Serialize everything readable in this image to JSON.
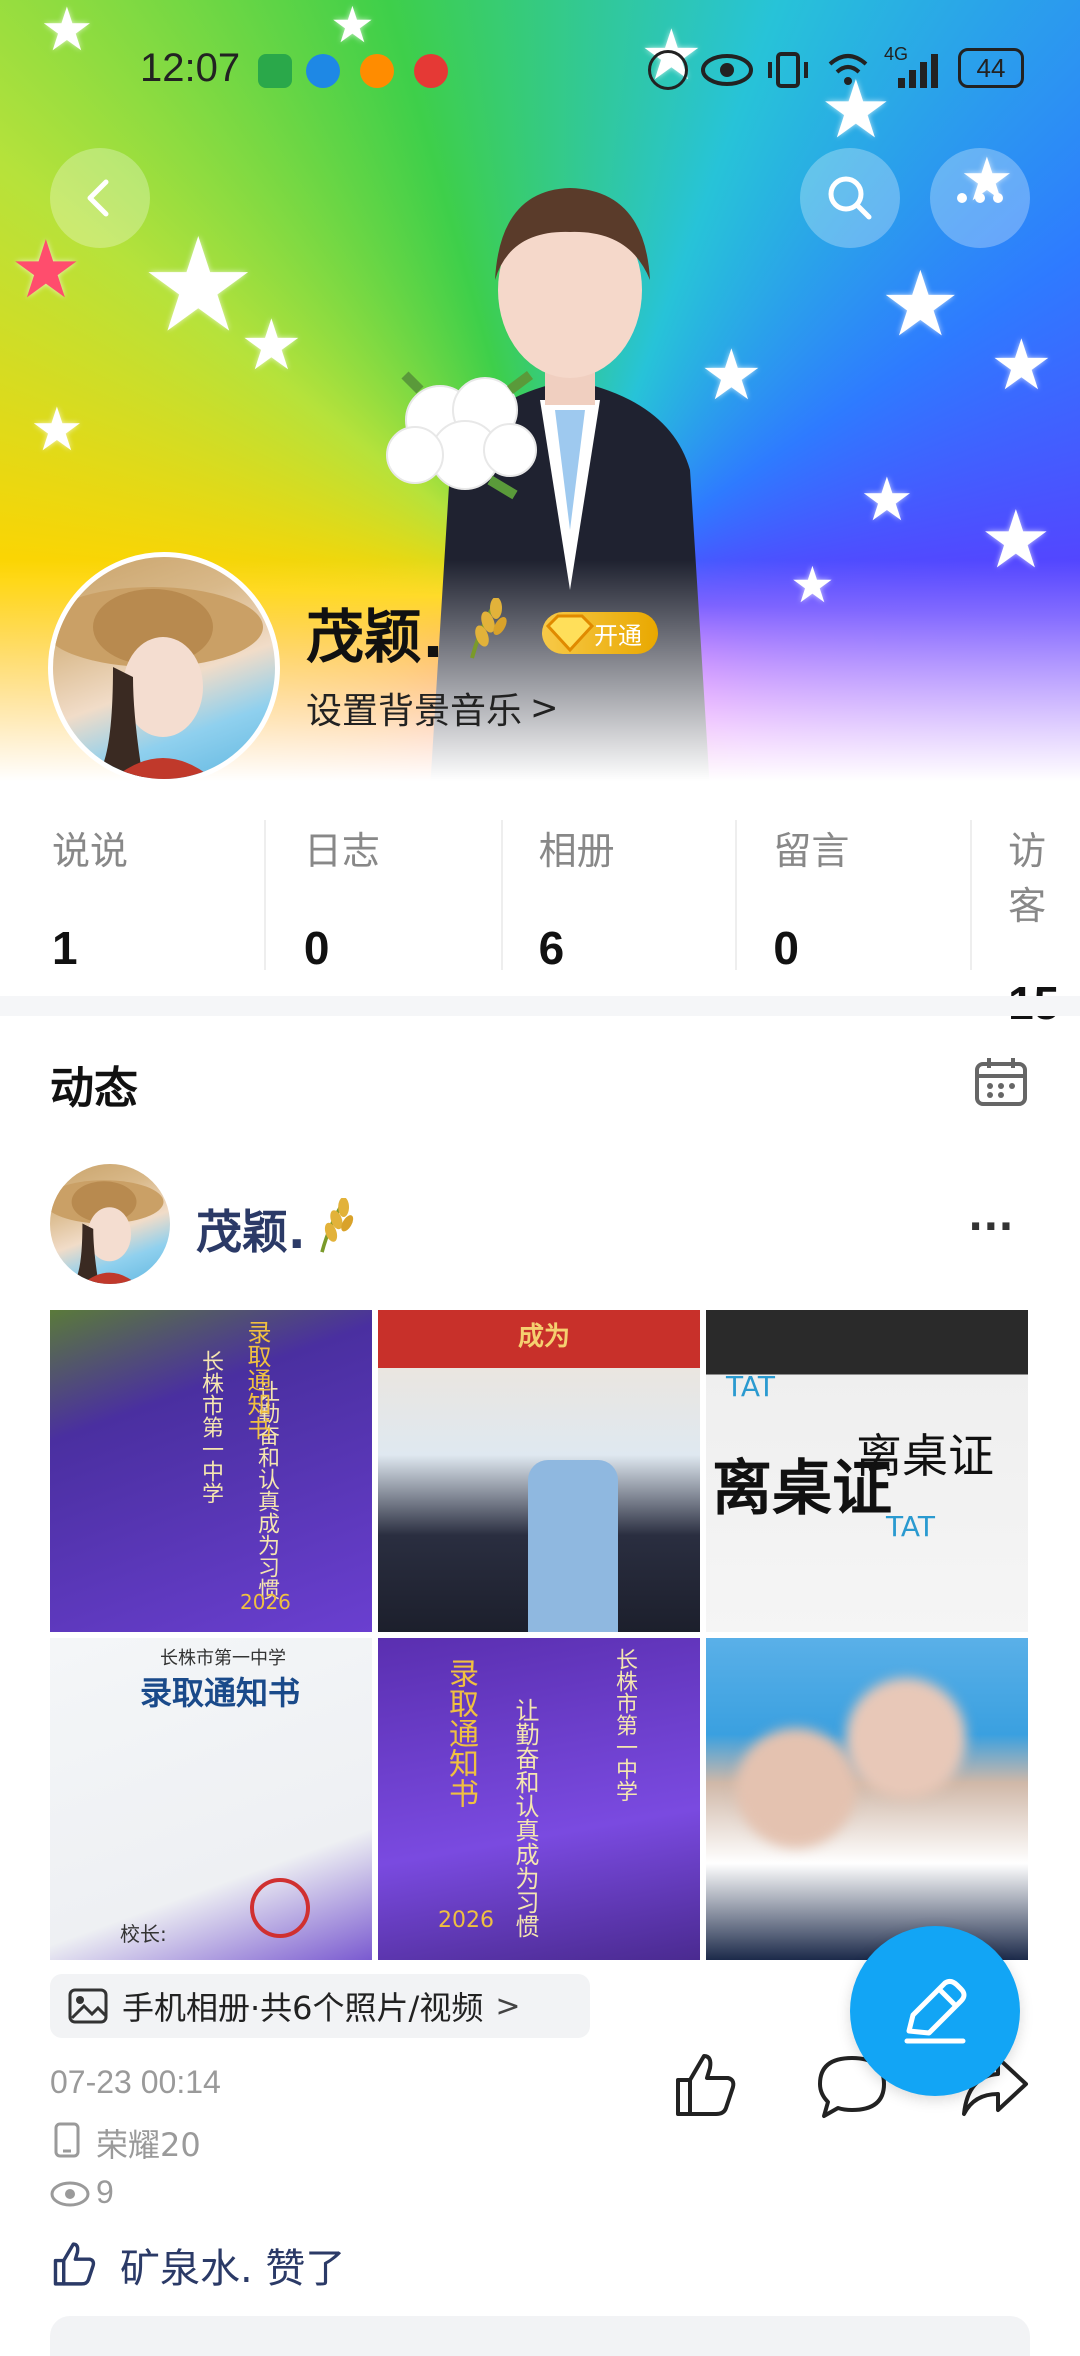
{
  "status_bar": {
    "time": "12:07",
    "network": "4G",
    "battery": "44"
  },
  "profile": {
    "name": "茂颖.",
    "vip_label": "开通",
    "music_prompt": "设置背景音乐",
    "music_chevron": ">"
  },
  "stats": [
    {
      "label": "说说",
      "value": "1"
    },
    {
      "label": "日志",
      "value": "0"
    },
    {
      "label": "相册",
      "value": "6"
    },
    {
      "label": "留言",
      "value": "0"
    },
    {
      "label": "访客",
      "value": "15"
    }
  ],
  "feed": {
    "section_title": "动态",
    "post": {
      "author": "茂颖.",
      "more": "···",
      "album_info": "手机相册·共6个照片/视频",
      "album_chevron": ">",
      "timestamp": "07-23 00:14",
      "device": "荣耀20",
      "views": "9",
      "liked_by": "矿泉水. 赞了",
      "photos": [
        {
          "texts": [
            "长株市第一中学",
            "录取通知书",
            "让勤奋和认真成为习惯",
            "2026"
          ]
        },
        {
          "texts": [
            "成为"
          ]
        },
        {
          "texts": [
            "离桌证",
            "离桌证",
            "TAT",
            "TAT"
          ]
        },
        {
          "texts": [
            "长株市第一中学",
            "录取通知书",
            "校长:"
          ]
        },
        {
          "texts": [
            "长株市第一中学",
            "录取通知书",
            "让勤奋和认真成为习惯",
            "2026"
          ]
        },
        {
          "texts": []
        }
      ]
    }
  },
  "colors": {
    "accent": "#12a5f5",
    "author_name": "#2b3a67",
    "gold": "#e9a800"
  },
  "icons": {
    "back": "back-arrow-icon",
    "search": "search-icon",
    "more": "more-icon",
    "calendar": "calendar-icon",
    "edit": "pencil-icon",
    "like": "thumbs-up-icon",
    "comment": "comment-icon",
    "share": "share-icon",
    "photo": "photo-icon",
    "device": "phone-icon",
    "views": "eye-icon"
  }
}
